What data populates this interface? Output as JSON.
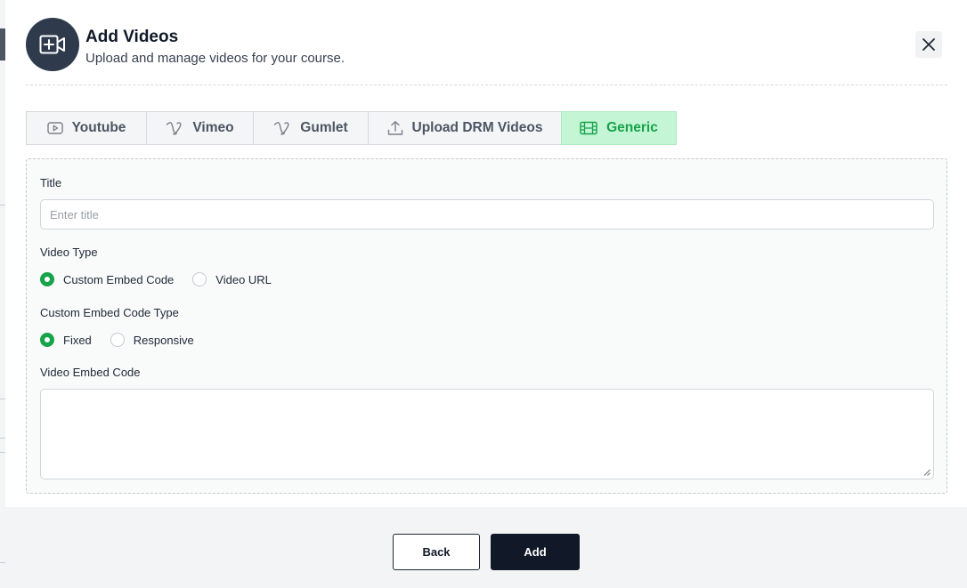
{
  "modal": {
    "title": "Add Videos",
    "subtitle": "Upload and manage videos for your course."
  },
  "tabs": [
    {
      "label": "Youtube",
      "icon": "youtube-icon",
      "active": false
    },
    {
      "label": "Vimeo",
      "icon": "vimeo-icon",
      "active": false
    },
    {
      "label": "Gumlet",
      "icon": "gumlet-icon",
      "active": false
    },
    {
      "label": "Upload DRM Videos",
      "icon": "upload-icon",
      "active": false
    },
    {
      "label": "Generic",
      "icon": "film-icon",
      "active": true
    }
  ],
  "form": {
    "title_label": "Title",
    "title_placeholder": "Enter title",
    "title_value": "",
    "video_type_label": "Video Type",
    "video_type_options": [
      {
        "label": "Custom Embed Code",
        "checked": true
      },
      {
        "label": "Video URL",
        "checked": false
      }
    ],
    "embed_type_label": "Custom Embed Code Type",
    "embed_type_options": [
      {
        "label": "Fixed",
        "checked": true
      },
      {
        "label": "Responsive",
        "checked": false
      }
    ],
    "embed_code_label": "Video Embed Code",
    "embed_code_value": ""
  },
  "footer": {
    "back_label": "Back",
    "add_label": "Add"
  },
  "colors": {
    "accent_green": "#16a34a",
    "active_tab_bg": "#c4f5d4",
    "dark_button": "#111827",
    "header_icon_bg": "#2f3b4c"
  }
}
